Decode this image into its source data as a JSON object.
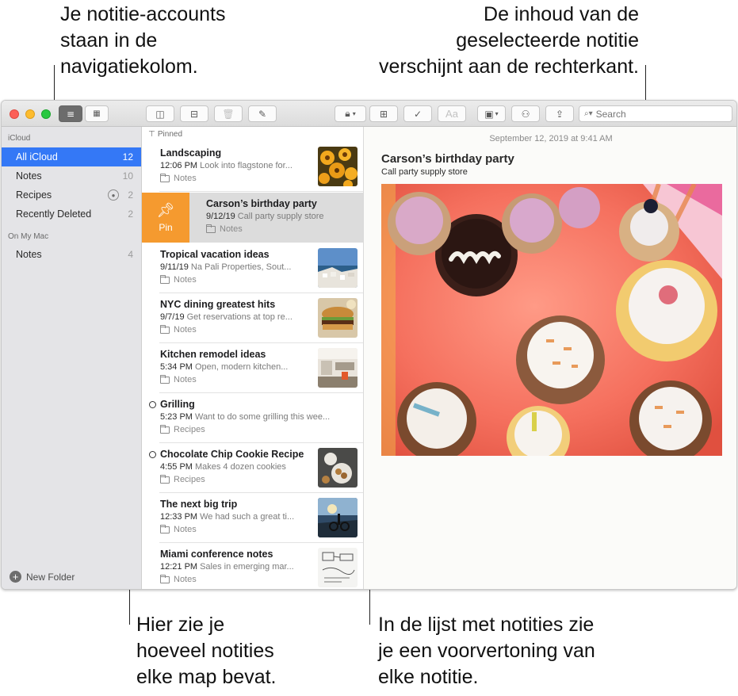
{
  "callouts": {
    "top_left": "Je notitie-accounts\nstaan in de\nnavigatiekolom.",
    "top_right": "De inhoud van de\ngeselecteerde notitie\nverschijnt aan de rechterkant.",
    "bottom_left": "Hier zie je\nhoeveel notities\nelke map bevat.",
    "bottom_right": "In de lijst met notities zie\nje een voorvertoning van\nelke notitie."
  },
  "toolbar": {
    "search_placeholder": "Search",
    "font_button_label": "Aa"
  },
  "sidebar": {
    "sections": [
      {
        "title": "iCloud",
        "items": [
          {
            "label": "All iCloud",
            "count": "12",
            "selected": true
          },
          {
            "label": "Notes",
            "count": "10"
          },
          {
            "label": "Recipes",
            "count": "2",
            "shared": true
          },
          {
            "label": "Recently Deleted",
            "count": "2"
          }
        ]
      },
      {
        "title": "On My Mac",
        "items": [
          {
            "label": "Notes",
            "count": "4"
          }
        ]
      }
    ],
    "new_folder_label": "New Folder"
  },
  "notelist": {
    "pinned_header": "Pinned",
    "pin_action_label": "Pin",
    "notes": [
      {
        "title": "Landscaping",
        "time": "12:06 PM",
        "snippet": "Look into flagstone for...",
        "folder": "Notes",
        "thumb": "flowers"
      },
      {
        "title": "Carson’s birthday party",
        "time": "9/12/19",
        "snippet": "Call party supply store",
        "folder": "Notes",
        "selected": true
      },
      {
        "title": "Tropical vacation ideas",
        "time": "9/11/19",
        "snippet": "Na Pali Properties, Sout...",
        "folder": "Notes",
        "thumb": "coast"
      },
      {
        "title": "NYC dining greatest hits",
        "time": "9/7/19",
        "snippet": "Get reservations at top re...",
        "folder": "Notes",
        "thumb": "burger"
      },
      {
        "title": "Kitchen remodel ideas",
        "time": "5:34 PM",
        "snippet": "Open, modern kitchen...",
        "folder": "Notes",
        "thumb": "kitchen"
      },
      {
        "title": "Grilling",
        "time": "5:23 PM",
        "snippet": "Want to do some grilling this wee...",
        "folder": "Recipes",
        "shared": true
      },
      {
        "title": "Chocolate Chip Cookie Recipe",
        "time": "4:55 PM",
        "snippet": "Makes 4 dozen cookies",
        "folder": "Recipes",
        "shared": true,
        "thumb": "cookies"
      },
      {
        "title": "The next big trip",
        "time": "12:33 PM",
        "snippet": "We had such a great ti...",
        "folder": "Notes",
        "thumb": "bike"
      },
      {
        "title": "Miami conference notes",
        "time": "12:21 PM",
        "snippet": "Sales in emerging mar...",
        "folder": "Notes",
        "thumb": "sketch"
      }
    ]
  },
  "detail": {
    "date": "September 12, 2019 at 9:41 AM",
    "title": "Carson’s birthday party",
    "subtitle": "Call party supply store"
  },
  "colors": {
    "selection_blue": "#3478f6",
    "pin_orange": "#f59a2f"
  }
}
